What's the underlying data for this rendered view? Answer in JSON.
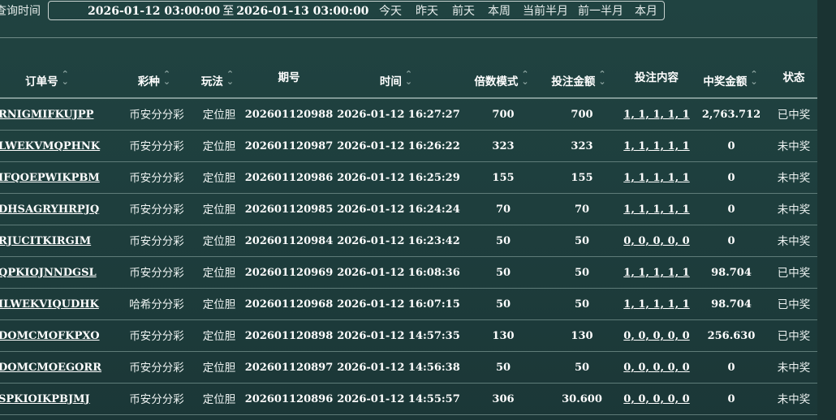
{
  "toolbar": {
    "query_label": "查询时间",
    "date_start": "2026-01-12 03:00:00",
    "date_sep": "至",
    "date_end": "2026-01-13 03:00:00",
    "quick": [
      {
        "label": "今天"
      },
      {
        "label": "昨天"
      },
      {
        "label": "前天"
      },
      {
        "label": "本周"
      },
      {
        "label": "当前半月"
      },
      {
        "label": "前一半月"
      },
      {
        "label": "本月"
      }
    ]
  },
  "table": {
    "headers": [
      {
        "label": "订单号",
        "sortable": true
      },
      {
        "label": "彩种",
        "sortable": true
      },
      {
        "label": "玩法",
        "sortable": true
      },
      {
        "label": "期号",
        "sortable": false
      },
      {
        "label": "时间",
        "sortable": true
      },
      {
        "label": "倍数模式",
        "sortable": true
      },
      {
        "label": "投注金额",
        "sortable": true
      },
      {
        "label": "投注内容",
        "sortable": false
      },
      {
        "label": "中奖金额",
        "sortable": true
      },
      {
        "label": "状态",
        "sortable": false
      }
    ],
    "rows": [
      {
        "order": "RNIGMIFKUJPP",
        "lottery": "币安分分彩",
        "play": "定位胆",
        "issue": "202601120988",
        "time": "2026-01-12 16:27:27",
        "multiple": "700",
        "bet": "700",
        "content": "1, 1, 1, 1, 1",
        "win": "2,763.712",
        "status": "已中奖"
      },
      {
        "order": "LWEKVMQPHNK",
        "lottery": "币安分分彩",
        "play": "定位胆",
        "issue": "202601120987",
        "time": "2026-01-12 16:26:22",
        "multiple": "323",
        "bet": "323",
        "content": "1, 1, 1, 1, 1",
        "win": "0",
        "status": "未中奖"
      },
      {
        "order": "IFQOEPWIKPBM",
        "lottery": "币安分分彩",
        "play": "定位胆",
        "issue": "202601120986",
        "time": "2026-01-12 16:25:29",
        "multiple": "155",
        "bet": "155",
        "content": "1, 1, 1, 1, 1",
        "win": "0",
        "status": "未中奖"
      },
      {
        "order": "DHSAGRYHRPJQ",
        "lottery": "币安分分彩",
        "play": "定位胆",
        "issue": "202601120985",
        "time": "2026-01-12 16:24:24",
        "multiple": "70",
        "bet": "70",
        "content": "1, 1, 1, 1, 1",
        "win": "0",
        "status": "未中奖"
      },
      {
        "order": "RJUCITKIRGIM",
        "lottery": "币安分分彩",
        "play": "定位胆",
        "issue": "202601120984",
        "time": "2026-01-12 16:23:42",
        "multiple": "50",
        "bet": "50",
        "content": "0, 0, 0, 0, 0",
        "win": "0",
        "status": "未中奖"
      },
      {
        "order": "QPKIOJNNDGSL",
        "lottery": "币安分分彩",
        "play": "定位胆",
        "issue": "202601120969",
        "time": "2026-01-12 16:08:36",
        "multiple": "50",
        "bet": "50",
        "content": "1, 1, 1, 1, 1",
        "win": "98.704",
        "status": "已中奖"
      },
      {
        "order": "ILWEKVIQUDHK",
        "lottery": "哈希分分彩",
        "play": "定位胆",
        "issue": "202601120968",
        "time": "2026-01-12 16:07:15",
        "multiple": "50",
        "bet": "50",
        "content": "1, 1, 1, 1, 1",
        "win": "98.704",
        "status": "已中奖"
      },
      {
        "order": "DOMCMOFKPXO",
        "lottery": "币安分分彩",
        "play": "定位胆",
        "issue": "202601120898",
        "time": "2026-01-12 14:57:35",
        "multiple": "130",
        "bet": "130",
        "content": "0, 0, 0, 0, 0",
        "win": "256.630",
        "status": "已中奖"
      },
      {
        "order": "DOMCMOEGORR",
        "lottery": "币安分分彩",
        "play": "定位胆",
        "issue": "202601120897",
        "time": "2026-01-12 14:56:38",
        "multiple": "50",
        "bet": "50",
        "content": "0, 0, 0, 0, 0",
        "win": "0",
        "status": "未中奖"
      },
      {
        "order": "SPKIOIKPBJMJ",
        "lottery": "币安分分彩",
        "play": "定位胆",
        "issue": "202601120896",
        "time": "2026-01-12 14:55:57",
        "multiple": "306",
        "bet": "30.600",
        "content": "0, 0, 0, 0, 0",
        "win": "0",
        "status": "未中奖"
      }
    ]
  }
}
